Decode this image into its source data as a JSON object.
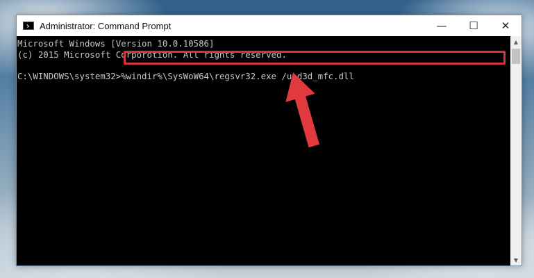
{
  "window": {
    "title": "Administrator: Command Prompt",
    "icon": "cmd-icon",
    "controls": {
      "minimize": "—",
      "maximize": "☐",
      "close": "✕"
    }
  },
  "console": {
    "line1": "Microsoft Windows [Version 10.0.10586]",
    "line2": "(c) 2015 Microsoft Corporotion. All rights reserved.",
    "prompt": "C:\\WINDOWS\\system32>",
    "command": "%windir%\\SysWoW64\\regsvr32.exe /u d3d_mfc.dll"
  },
  "annotations": {
    "highlight_color": "#d9333a",
    "arrow_icon": "red-arrow-icon"
  },
  "scrollbar": {
    "up": "▲",
    "down": "▼"
  }
}
